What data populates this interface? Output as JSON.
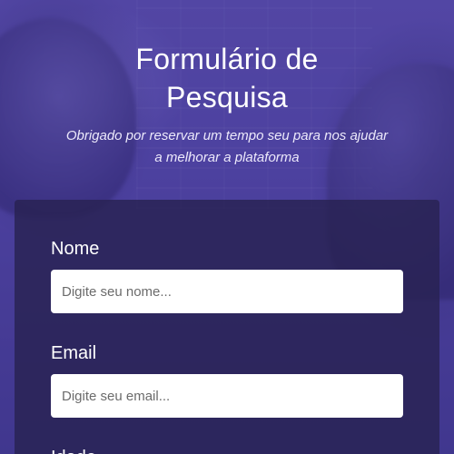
{
  "header": {
    "title": "Formulário de Pesquisa",
    "subtitle": "Obrigado por reservar um tempo seu para nos ajudar a melhorar a plataforma"
  },
  "form": {
    "fields": [
      {
        "label": "Nome",
        "placeholder": "Digite seu nome...",
        "value": ""
      },
      {
        "label": "Email",
        "placeholder": "Digite seu email...",
        "value": ""
      },
      {
        "label": "Idade"
      }
    ]
  },
  "colors": {
    "overlay": "#4a3f8f",
    "card": "#28224f",
    "text": "#ffffff",
    "input_bg": "#ffffff"
  }
}
